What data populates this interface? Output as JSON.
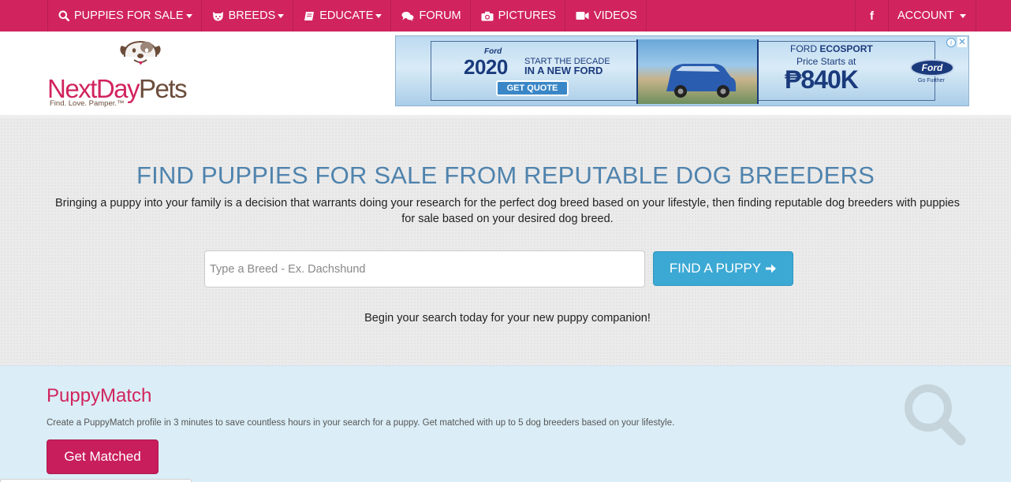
{
  "nav": {
    "items": [
      {
        "label": "PUPPIES FOR SALE",
        "icon": "search-icon",
        "dropdown": true
      },
      {
        "label": "BREEDS",
        "icon": "dog-face-icon",
        "dropdown": true
      },
      {
        "label": "EDUCATE",
        "icon": "book-icon",
        "dropdown": true
      },
      {
        "label": "FORUM",
        "icon": "chat-bubbles-icon",
        "dropdown": false
      },
      {
        "label": "PICTURES",
        "icon": "camera-icon",
        "dropdown": false
      },
      {
        "label": "VIDEOS",
        "icon": "video-camera-icon",
        "dropdown": false
      }
    ],
    "facebook": "f",
    "account": "ACCOUNT"
  },
  "logo": {
    "word_pink": "NextDay",
    "word_brown": "Pets",
    "tagline": "Find. Love. Pamper.™"
  },
  "ad": {
    "brand_small": "Ford",
    "year": "2020",
    "slogan_line1": "START THE DECADE",
    "slogan_line2": "IN A NEW FORD",
    "button": "GET QUOTE",
    "model_brand": "FORD",
    "model_name": "ECOSPORT",
    "price_label": "Price Starts at",
    "price": "₱840K",
    "logo_text": "Ford",
    "logo_sub": "Go Further",
    "info": "i",
    "close": "✕"
  },
  "hero": {
    "title": "FIND PUPPIES FOR SALE FROM REPUTABLE DOG BREEDERS",
    "description": "Bringing a puppy into your family is a decision that warrants doing your research for the perfect dog breed based on your lifestyle, then finding reputable dog breeders with puppies for sale based on your desired dog breed.",
    "search_placeholder": "Type a Breed - Ex. Dachshund",
    "search_value": "",
    "button": "FIND A PUPPY",
    "subtext": "Begin your search today for your new puppy companion!"
  },
  "puppymatch": {
    "title": "PuppyMatch",
    "description": "Create a PuppyMatch profile in 3 minutes to save countless hours in your search for a puppy. Get matched with up to 5 dog breeders based on your lifestyle.",
    "button": "Get Matched"
  },
  "colors": {
    "brand_pink": "#d1245e",
    "logo_brown": "#6b4c3a",
    "hero_title_blue": "#4f83ad",
    "button_blue": "#3ba9d4",
    "puppymatch_bg": "#dbeef7"
  }
}
